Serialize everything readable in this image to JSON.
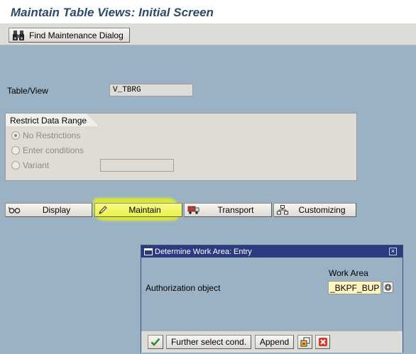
{
  "screen": {
    "title": "Maintain Table Views: Initial Screen"
  },
  "toolbar": {
    "find_label": "Find Maintenance Dialog"
  },
  "form": {
    "table_view_label": "Table/View",
    "table_view_value": "V_TBRG",
    "restrict": {
      "title": "Restrict Data Range",
      "options": [
        {
          "label": "No Restrictions",
          "selected": true
        },
        {
          "label": "Enter conditions",
          "selected": false
        },
        {
          "label": "Variant",
          "selected": false
        }
      ],
      "variant_value": ""
    }
  },
  "actions": [
    {
      "label": "Display",
      "icon": "glasses-icon"
    },
    {
      "label": "Maintain",
      "icon": "pencil-icon"
    },
    {
      "label": "Transport",
      "icon": "truck-icon"
    },
    {
      "label": "Customizing",
      "icon": "hierarchy-icon"
    }
  ],
  "dialog": {
    "title": "Determine Work Area: Entry",
    "column_header": "Work Area",
    "field_label": "Authorization object",
    "field_value": "_BKPF_BUP",
    "buttons": {
      "confirm_icon": "check-icon",
      "further_label": "Further select cond.",
      "append_label": "Append",
      "multi_icon": "multiple-selection-icon",
      "cancel_icon": "cancel-icon"
    }
  },
  "colors": {
    "background": "#9ab2c4",
    "highlight": "#e6f01e",
    "dialog_title": "#2c3b80",
    "input_yellow": "#fdf4c0"
  }
}
